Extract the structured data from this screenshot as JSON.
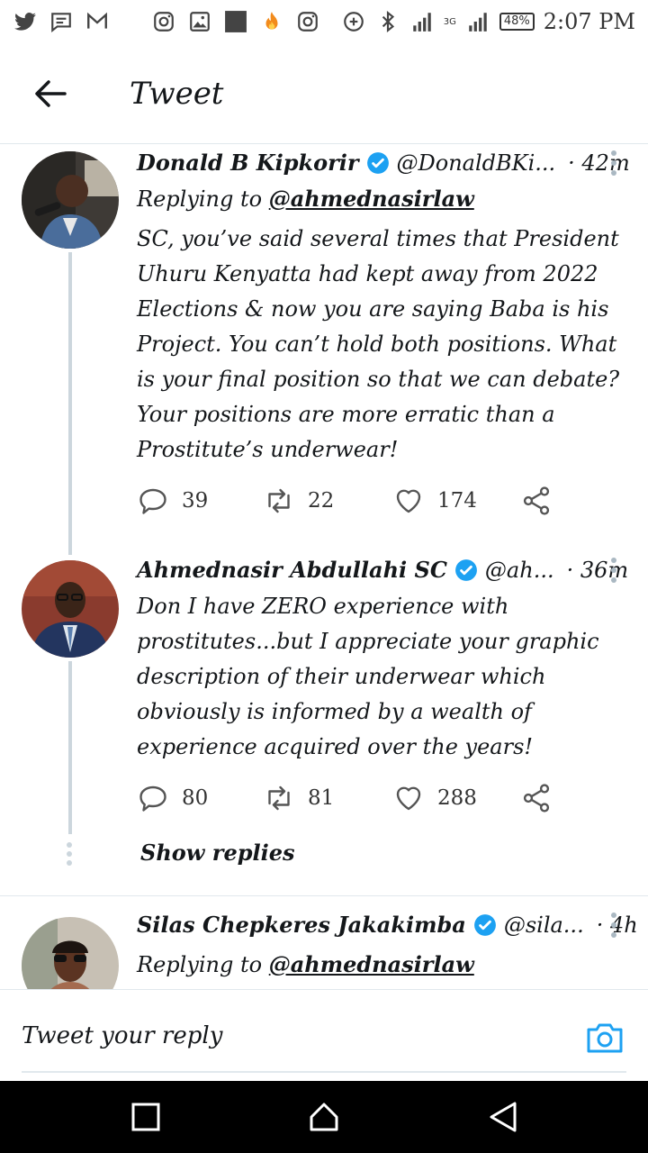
{
  "status_bar": {
    "time": "2:07 PM",
    "battery": "48%",
    "network": "3G",
    "left_icons": [
      "twitter-icon",
      "message-icon",
      "gmail-icon",
      "instagram-icon",
      "gallery-icon",
      "square-icon",
      "fire-icon",
      "instagram-icon"
    ],
    "right_icons": [
      "data-saver-icon",
      "bluetooth-icon",
      "signal-icon"
    ]
  },
  "header": {
    "title": "Tweet",
    "back_icon": "arrow-left-icon"
  },
  "tweets": [
    {
      "name": "Donald B Kipkorir",
      "handle": "@DonaldBKi...",
      "time": "· 42m",
      "replying_prefix": "Replying to",
      "replying_handle": "@ahmednasirlaw",
      "body": "SC, you’ve said several times that President Uhuru Kenyatta had kept away from 2022 Elections & now you are saying Baba is his Project. You can’t hold both positions. What is your final position so that we can debate? Your positions are more erratic than a Prostitute’s underwear!",
      "replies": "39",
      "retweets": "22",
      "likes": "174"
    },
    {
      "name": "Ahmednasir Abdullahi SC",
      "handle": "@ah...",
      "time": "· 36m",
      "body": "Don I have ZERO experience with prostitutes...but I appreciate your graphic description of their underwear which obviously is informed by a wealth of experience acquired over the years!",
      "replies": "80",
      "retweets": "81",
      "likes": "288"
    },
    {
      "name": "Silas Chepkeres Jakakimba",
      "handle": "@sila...",
      "time": "· 4h",
      "replying_prefix": "Replying to",
      "replying_handle": "@ahmednasirlaw"
    }
  ],
  "show_replies": "Show replies",
  "composer": {
    "placeholder": "Tweet your reply",
    "camera_icon": "camera-icon"
  },
  "colors": {
    "accent": "#1da1f2",
    "thread_line": "#ccd6dd",
    "divider": "#e1e8ed"
  }
}
